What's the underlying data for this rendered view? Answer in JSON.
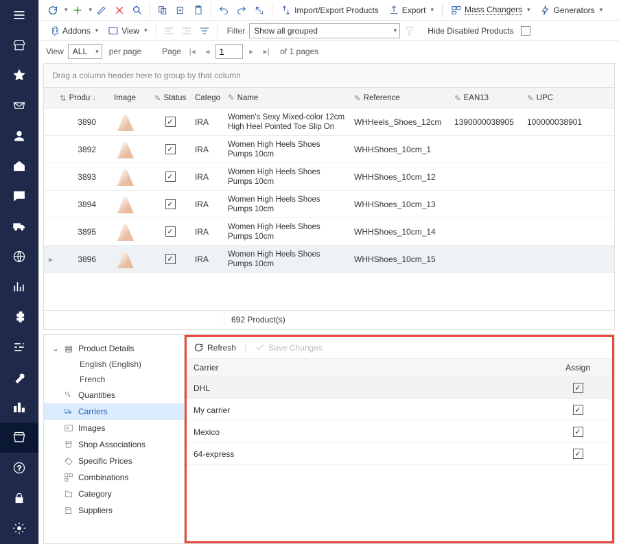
{
  "toolbar": {
    "import_export": "Import/Export Products",
    "export": "Export",
    "mass_changers": "Mass Changers",
    "generators": "Generators",
    "addons": "Addons",
    "view": "View",
    "filter_label": "Filter",
    "filter_value": "Show all grouped",
    "hide_disabled": "Hide Disabled Products"
  },
  "pager": {
    "view_label": "View",
    "view_all": "ALL",
    "per_page": "per page",
    "page_label": "Page",
    "page_value": "1",
    "of_pages": "of 1 pages"
  },
  "groupbar_hint": "Drag a column header here to group by that column",
  "columns": {
    "product": "Produ",
    "image": "Image",
    "status": "Status",
    "category": "Catego",
    "name": "Name",
    "reference": "Reference",
    "ean": "EAN13",
    "upc": "UPC"
  },
  "rows": [
    {
      "id": "3890",
      "cat": "IRA",
      "name": "Women's Sexy Mixed-color 12cm High Heel Pointed Toe Slip On",
      "ref": "WHHeels_Shoes_12cm",
      "ean": "1390000038905",
      "upc": "100000038901"
    },
    {
      "id": "3892",
      "cat": "IRA",
      "name": "Women High Heels Shoes Pumps 10cm",
      "ref": "WHHShoes_10cm_1",
      "ean": "",
      "upc": ""
    },
    {
      "id": "3893",
      "cat": "IRA",
      "name": "Women High Heels Shoes Pumps 10cm",
      "ref": "WHHShoes_10cm_12",
      "ean": "",
      "upc": ""
    },
    {
      "id": "3894",
      "cat": "IRA",
      "name": "Women High Heels Shoes Pumps 10cm",
      "ref": "WHHShoes_10cm_13",
      "ean": "",
      "upc": ""
    },
    {
      "id": "3895",
      "cat": "IRA",
      "name": "Women High Heels Shoes Pumps 10cm",
      "ref": "WHHShoes_10cm_14",
      "ean": "",
      "upc": ""
    },
    {
      "id": "3896",
      "cat": "IRA",
      "name": "Women High Heels Shoes Pumps 10cm",
      "ref": "WHHShoes_10cm_15",
      "ean": "",
      "upc": ""
    }
  ],
  "footer_summary": "692 Product(s)",
  "tree": {
    "root": "Product Details",
    "lang_en": "English (English)",
    "lang_fr": "French",
    "quantities": "Quantities",
    "carriers": "Carriers",
    "images": "Images",
    "shop_assoc": "Shop Associations",
    "specific_prices": "Specific Prices",
    "combinations": "Combinations",
    "category": "Category",
    "suppliers": "Suppliers"
  },
  "detail": {
    "refresh": "Refresh",
    "save": "Save Changes",
    "col_carrier": "Carrier",
    "col_assign": "Assign",
    "rows": [
      {
        "name": "DHL"
      },
      {
        "name": "My carrier"
      },
      {
        "name": "Mexico"
      },
      {
        "name": "64-express"
      }
    ]
  }
}
